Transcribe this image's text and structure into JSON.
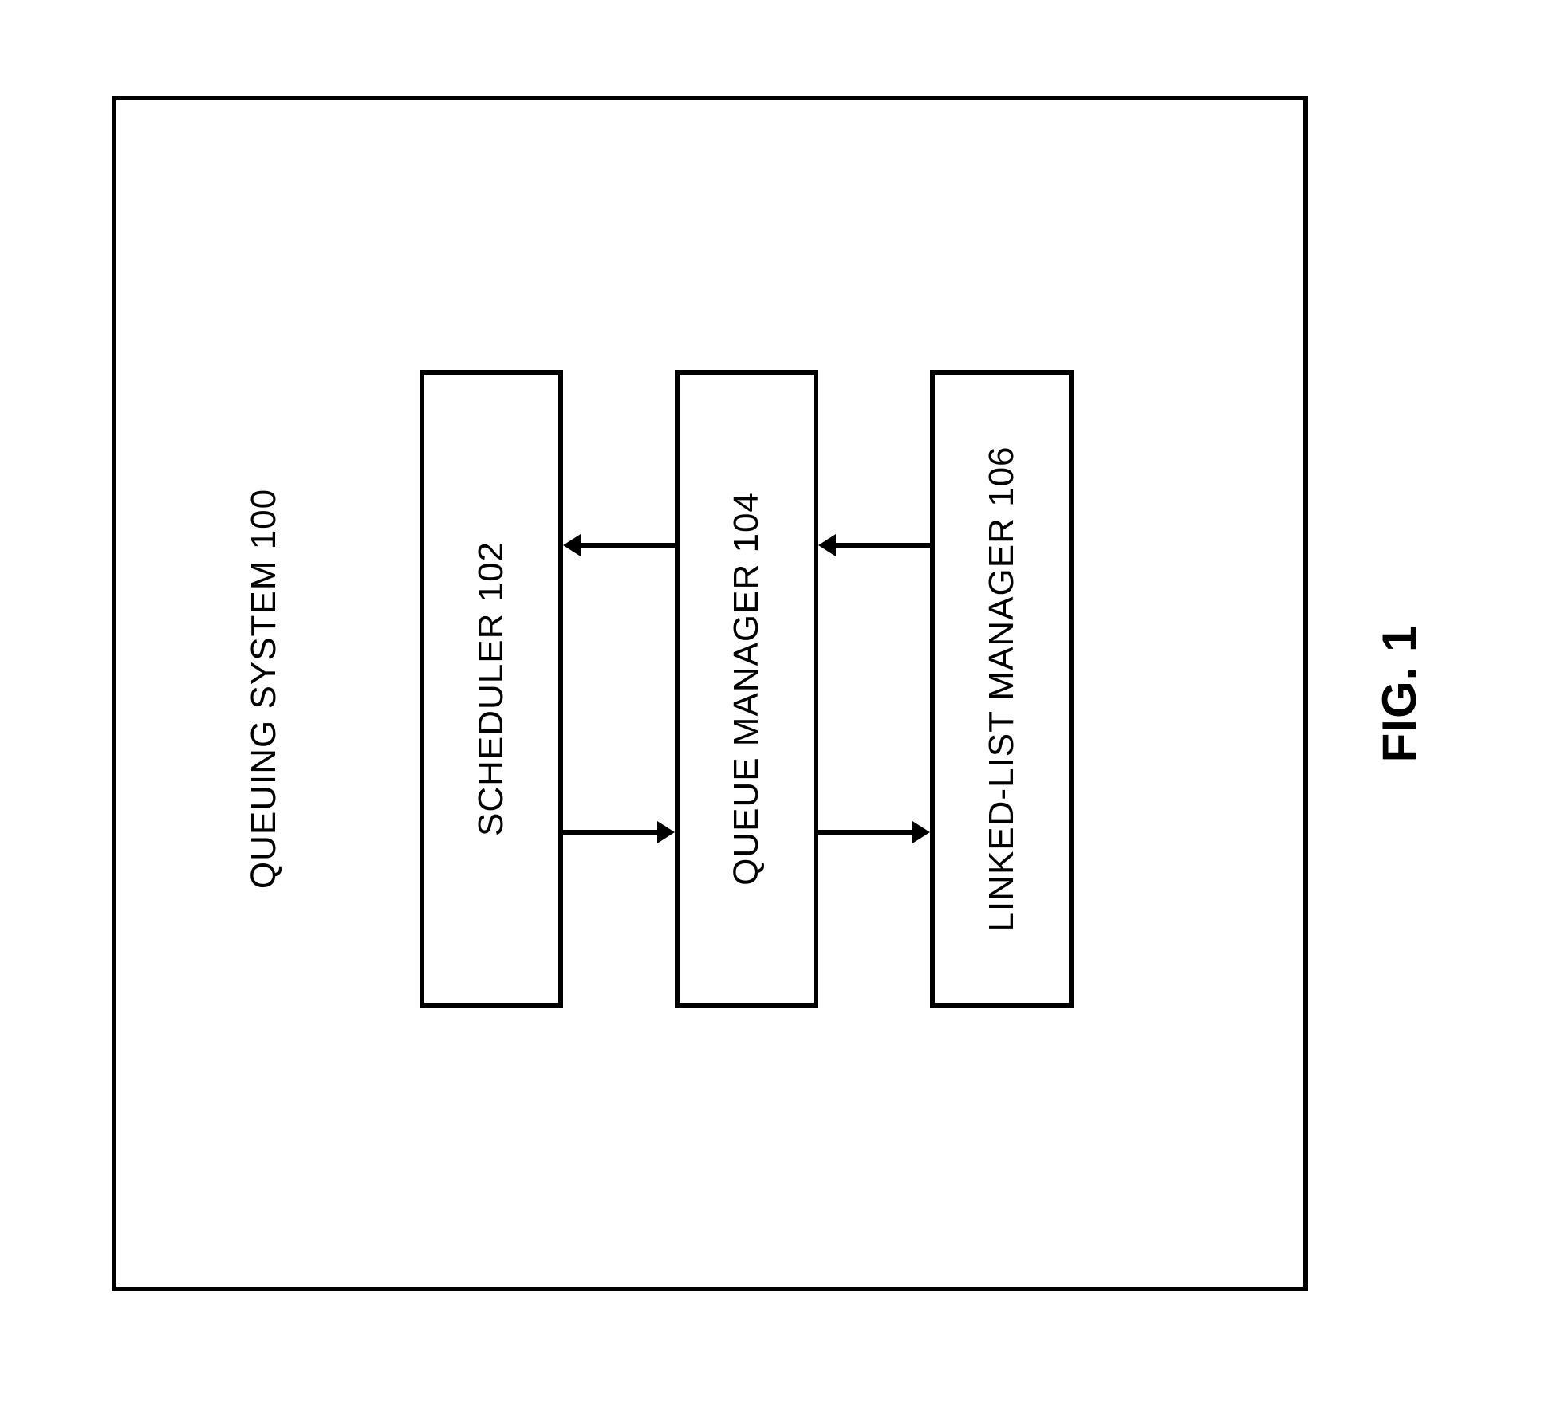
{
  "figure_label": "FIG. 1",
  "system": {
    "title": "QUEUING SYSTEM 100",
    "blocks": {
      "scheduler": "SCHEDULER 102",
      "queue_manager": "QUEUE MANAGER 104",
      "linked_list_manager": "LINKED-LIST MANAGER 106"
    }
  },
  "connections": [
    {
      "from": "scheduler",
      "to": "queue_manager",
      "bidirectional": true
    },
    {
      "from": "queue_manager",
      "to": "linked_list_manager",
      "bidirectional": true
    }
  ]
}
